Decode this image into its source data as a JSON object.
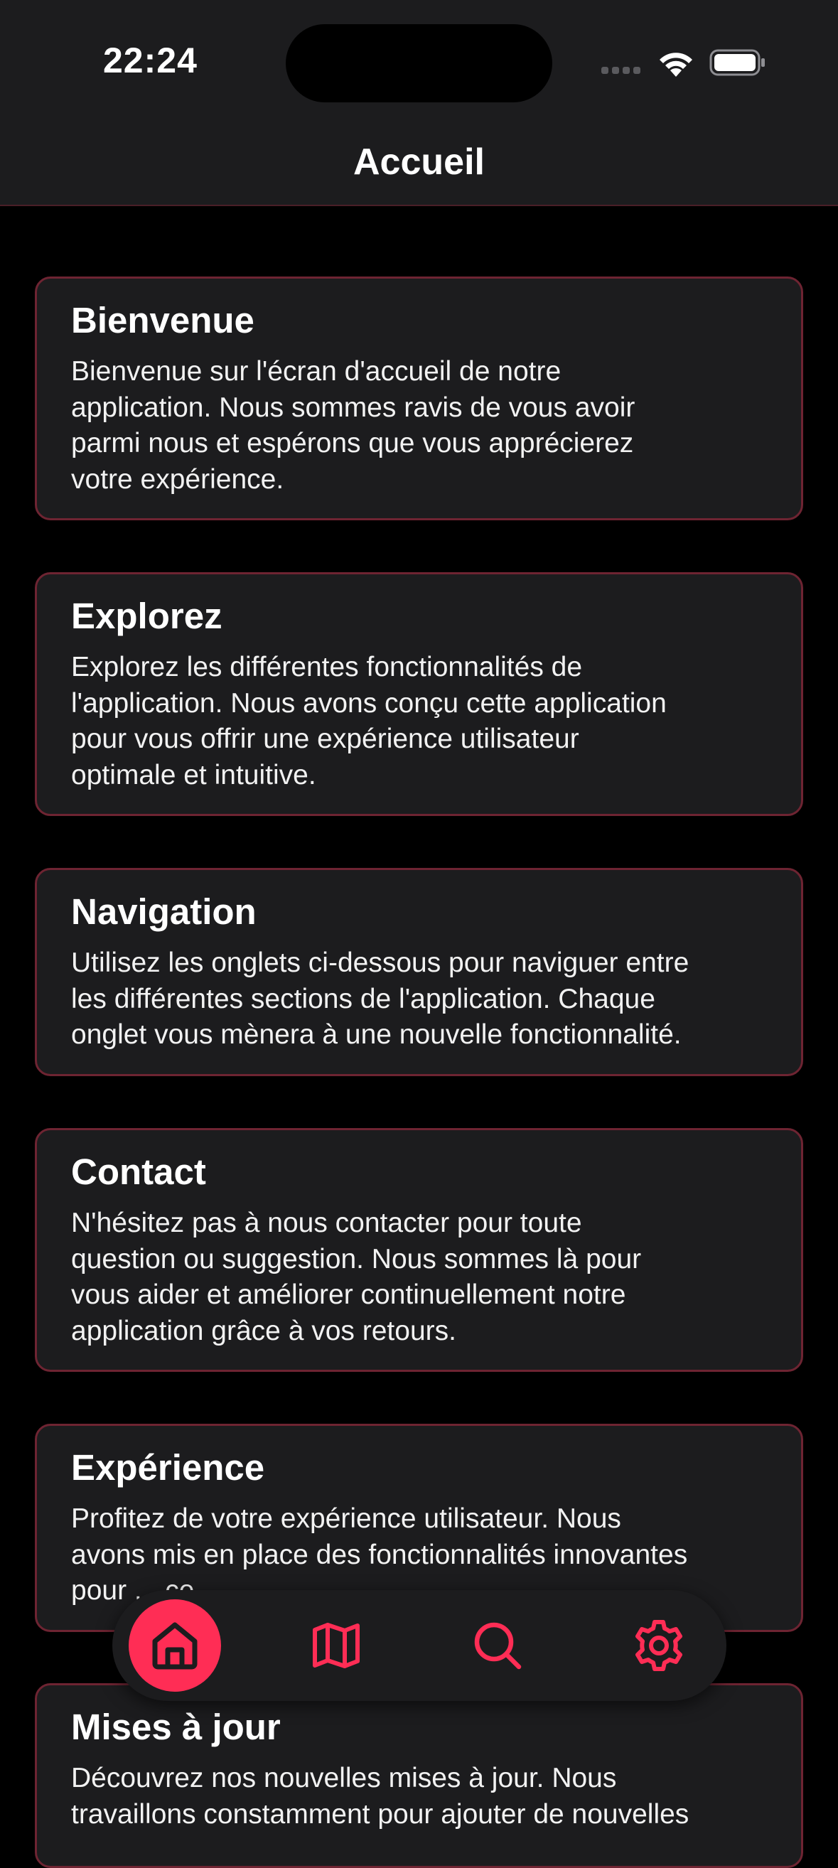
{
  "status_bar": {
    "time": "22:24"
  },
  "header": {
    "title": "Accueil"
  },
  "accent_color": "#ff2d55",
  "cards": [
    {
      "title": "Bienvenue",
      "body": "Bienvenue sur l'écran d'accueil de notre\napplication. Nous sommes ravis de vous avoir\nparmi nous et espérons que vous apprécierez\nvotre expérience."
    },
    {
      "title": "Explorez",
      "body": "Explorez les différentes fonctionnalités de\nl'application. Nous avons conçu cette application\npour vous offrir une expérience utilisateur\noptimale et intuitive."
    },
    {
      "title": "Navigation",
      "body": "Utilisez les onglets ci-dessous pour naviguer entre\nles différentes sections de l'application. Chaque\nonglet vous mènera à une nouvelle fonctionnalité."
    },
    {
      "title": "Contact",
      "body": "N'hésitez pas à nous contacter pour toute\nquestion ou suggestion. Nous sommes là pour\nvous aider et améliorer continuellement notre\napplication grâce à vos retours."
    },
    {
      "title": "Expérience",
      "body": "Profitez de votre expérience utilisateur. Nous\navons mis en place des fonctionnalités innovantes\npour ... ce."
    },
    {
      "title": "Mises à jour",
      "body": "Découvrez nos nouvelles mises à jour. Nous\ntravaillons constamment pour ajouter de nouvelles"
    }
  ],
  "tab_bar": {
    "tabs": [
      {
        "icon": "home-icon",
        "active": true
      },
      {
        "icon": "map-icon",
        "active": false
      },
      {
        "icon": "search-icon",
        "active": false
      },
      {
        "icon": "gear-icon",
        "active": false
      }
    ]
  }
}
